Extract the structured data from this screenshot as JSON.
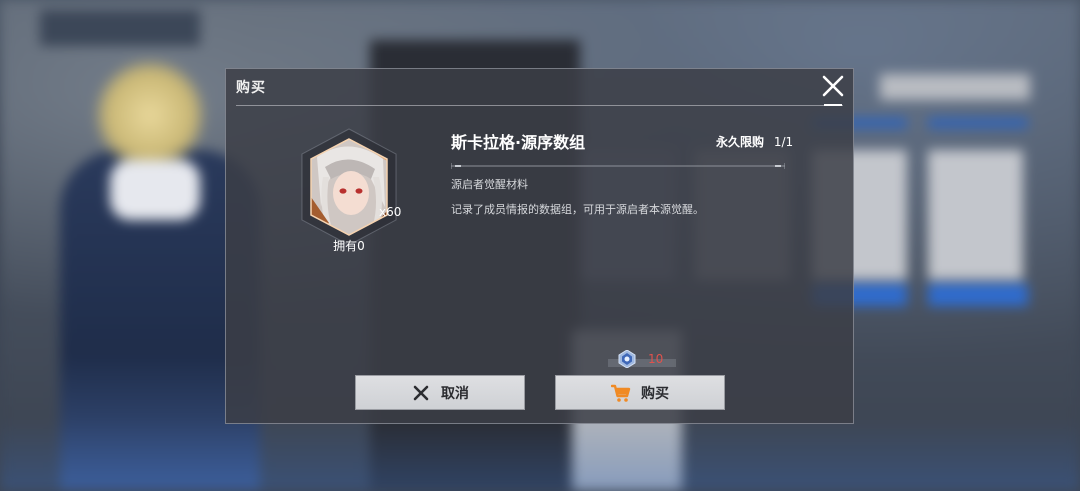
{
  "dialog": {
    "title": "购买",
    "close_icon": "close-icon"
  },
  "item": {
    "name": "斯卡拉格·源序数组",
    "quantity": "x60",
    "owned": "拥有0",
    "type": "源启者觉醒材料",
    "description": "记录了成员情报的数据组，可用于源启者本源觉醒。",
    "limit_label": "永久限购",
    "limit_value": "1/1",
    "frame_color": "#d9935a",
    "icon": "character-portrait-icon"
  },
  "price": {
    "amount": "10",
    "currency_icon": "crystal-currency-icon",
    "amount_color": "#e0524d"
  },
  "buttons": {
    "cancel_label": "取消",
    "cancel_icon": "x-icon",
    "buy_label": "购买",
    "buy_icon": "cart-icon",
    "buy_icon_color": "#f08a24"
  }
}
